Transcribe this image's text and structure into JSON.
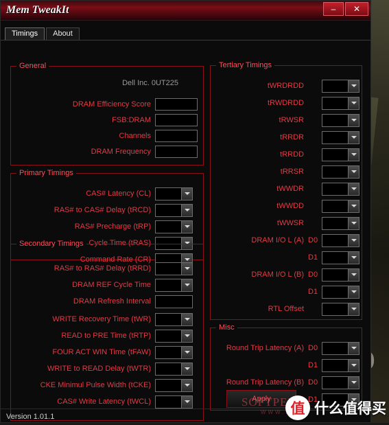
{
  "window": {
    "title": "Mem TweakIt",
    "minimize_label": "–",
    "close_label": "✕",
    "version": "Version 1.01.1",
    "apply_label": "Apply"
  },
  "tabs": [
    {
      "label": "Timings",
      "active": true
    },
    {
      "label": "About",
      "active": false
    }
  ],
  "general": {
    "legend": "General",
    "vendor": "Dell Inc. 0UT225",
    "fields": [
      {
        "label": "DRAM Efficiency Score",
        "value": ""
      },
      {
        "label": "FSB:DRAM",
        "value": ""
      },
      {
        "label": "Channels",
        "value": ""
      },
      {
        "label": "DRAM Frequency",
        "value": ""
      }
    ]
  },
  "primary": {
    "legend": "Primary Timings",
    "fields": [
      {
        "label": "CAS# Latency (CL)",
        "value": ""
      },
      {
        "label": "RAS# to CAS# Delay (tRCD)",
        "value": ""
      },
      {
        "label": "RAS# Precharge (tRP)",
        "value": ""
      },
      {
        "label": "Cycle Time (tRAS)",
        "value": ""
      },
      {
        "label": "Command Rate (CR)",
        "value": ""
      }
    ]
  },
  "secondary": {
    "legend": "Secondary Timings",
    "fields": [
      {
        "label": "RAS# to RAS# Delay (tRRD)",
        "value": "",
        "type": "combo"
      },
      {
        "label": "DRAM REF Cycle Time",
        "value": "",
        "type": "combo"
      },
      {
        "label": "DRAM Refresh Interval",
        "value": "",
        "type": "text"
      },
      {
        "label": "WRITE Recovery Time (tWR)",
        "value": "",
        "type": "combo"
      },
      {
        "label": "READ to PRE Time (tRTP)",
        "value": "",
        "type": "combo"
      },
      {
        "label": "FOUR ACT WIN Time (tFAW)",
        "value": "",
        "type": "combo"
      },
      {
        "label": "WRITE to READ Delay (tWTR)",
        "value": "",
        "type": "combo"
      },
      {
        "label": "CKE Minimul Pulse Width (tCKE)",
        "value": "",
        "type": "combo"
      },
      {
        "label": "CAS# Write Latency (tWCL)",
        "value": "",
        "type": "combo"
      }
    ]
  },
  "tertiary": {
    "legend": "Tertiary Timings",
    "fields": [
      {
        "label": "tWRDRDD",
        "sub": "",
        "value": ""
      },
      {
        "label": "tRWDRDD",
        "sub": "",
        "value": ""
      },
      {
        "label": "tRWSR",
        "sub": "",
        "value": ""
      },
      {
        "label": "tRRDR",
        "sub": "",
        "value": ""
      },
      {
        "label": "tRRDD",
        "sub": "",
        "value": ""
      },
      {
        "label": "tRRSR",
        "sub": "",
        "value": ""
      },
      {
        "label": "tWWDR",
        "sub": "",
        "value": ""
      },
      {
        "label": "tWWDD",
        "sub": "",
        "value": ""
      },
      {
        "label": "tWWSR",
        "sub": "",
        "value": ""
      },
      {
        "label": "DRAM I/O L (A)",
        "sub": "D0",
        "value": ""
      },
      {
        "label": "",
        "sub": "D1",
        "value": ""
      },
      {
        "label": "DRAM I/O L (B)",
        "sub": "D0",
        "value": ""
      },
      {
        "label": "",
        "sub": "D1",
        "value": ""
      },
      {
        "label": "RTL Offset",
        "sub": "",
        "value": ""
      }
    ]
  },
  "misc": {
    "legend": "Misc",
    "fields": [
      {
        "label": "Round Trip Latency (A)",
        "sub": "D0",
        "value": ""
      },
      {
        "label": "",
        "sub": "D1",
        "value": ""
      },
      {
        "label": "Round Trip Latency (B)",
        "sub": "D0",
        "value": ""
      },
      {
        "label": "",
        "sub": "D1",
        "value": ""
      }
    ]
  },
  "watermarks": {
    "softpedia_main": "SOFTPEDIA",
    "softpedia_sub": "WWW.S",
    "desktop_letter": "D",
    "badge_mark": "值",
    "badge_text": "什么值得买"
  },
  "colors": {
    "accent_red": "#e23b46",
    "legend_red": "#ff4d5a",
    "border_red": "#8a1018",
    "title_gradient_top": "#7a0d16"
  }
}
